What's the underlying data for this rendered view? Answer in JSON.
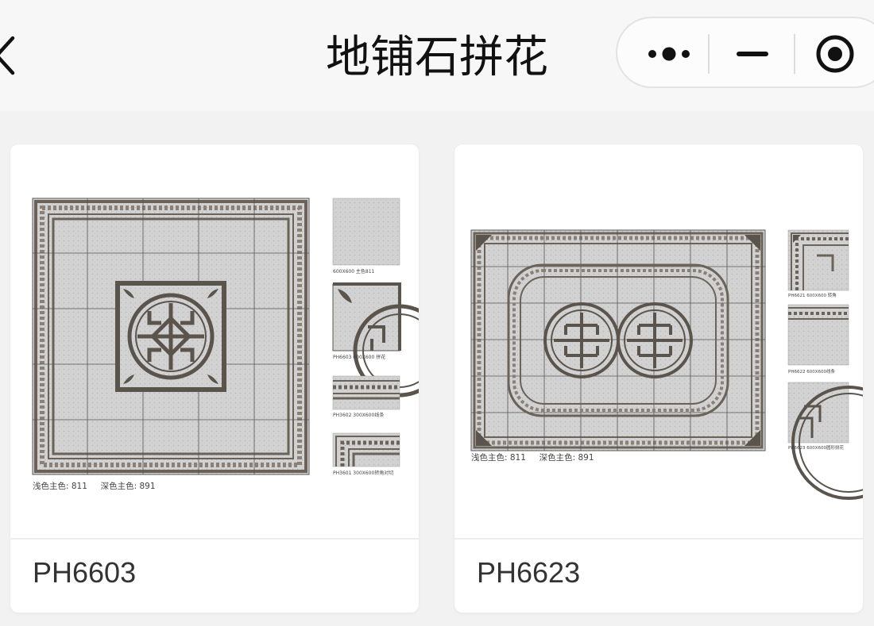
{
  "header": {
    "title": "地铺石拼花"
  },
  "capsule": {
    "icons": [
      "more-icon",
      "minimize-icon",
      "close-target-icon"
    ]
  },
  "products": [
    {
      "code": "PH6603",
      "color_label": "浅色主色: 811     深色主色: 891",
      "captions": [
        "600X600 主色811",
        "PH6603  600X600 拼花",
        "PH3602  300X600线条",
        "PH3601  300X600转角对切"
      ]
    },
    {
      "code": "PH6623",
      "color_label": "浅色主色: 811     深色主色: 891",
      "captions": [
        "PH6621  600X600 转角",
        "PH6622  600X600线条",
        "PH6623  600X600圆形拼花"
      ]
    }
  ]
}
